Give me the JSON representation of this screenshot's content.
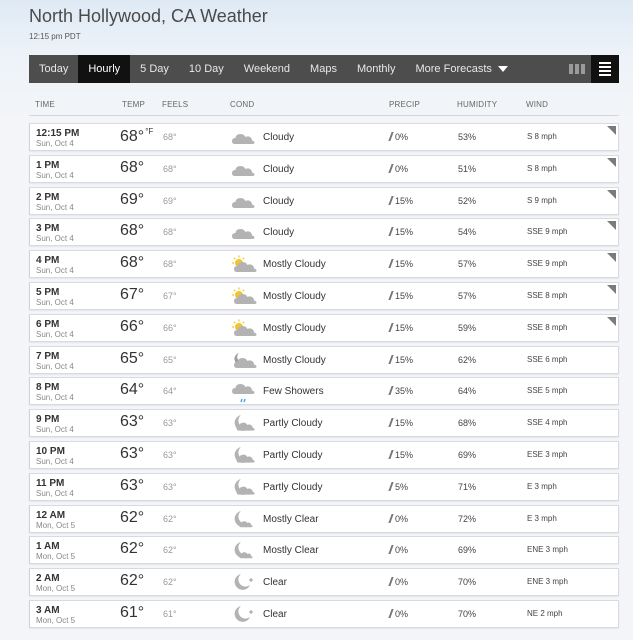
{
  "header": {
    "title": "North Hollywood, CA Weather",
    "timestamp": "12:15 pm PDT"
  },
  "nav": {
    "tabs": [
      "Today",
      "Hourly",
      "5 Day",
      "10 Day",
      "Weekend",
      "Maps",
      "Monthly",
      "More Forecasts"
    ],
    "active": "Hourly"
  },
  "columns": {
    "time": "TIME",
    "temp": "TEMP",
    "feels": "FEELS",
    "cond": "COND",
    "precip": "PRECIP",
    "humidity": "HUMIDITY",
    "wind": "WIND"
  },
  "rows": [
    {
      "time": "12:15 PM",
      "date": "Sun, Oct 4",
      "temp": "68°",
      "unit": "°F",
      "feels": "68°",
      "icon": "cloudy-icon",
      "cond": "Cloudy",
      "precip": "0%",
      "humidity": "53%",
      "wind": "S 8 mph",
      "expand": true
    },
    {
      "time": "1 PM",
      "date": "Sun, Oct 4",
      "temp": "68°",
      "feels": "68°",
      "icon": "cloudy-icon",
      "cond": "Cloudy",
      "precip": "0%",
      "humidity": "51%",
      "wind": "S 8 mph",
      "expand": true
    },
    {
      "time": "2 PM",
      "date": "Sun, Oct 4",
      "temp": "69°",
      "feels": "69°",
      "icon": "cloudy-icon",
      "cond": "Cloudy",
      "precip": "15%",
      "humidity": "52%",
      "wind": "S 9 mph",
      "expand": true
    },
    {
      "time": "3 PM",
      "date": "Sun, Oct 4",
      "temp": "68°",
      "feels": "68°",
      "icon": "cloudy-icon",
      "cond": "Cloudy",
      "precip": "15%",
      "humidity": "54%",
      "wind": "SSE 9 mph",
      "expand": true
    },
    {
      "time": "4 PM",
      "date": "Sun, Oct 4",
      "temp": "68°",
      "feels": "68°",
      "icon": "mostly-cloudy-day-icon",
      "cond": "Mostly Cloudy",
      "precip": "15%",
      "humidity": "57%",
      "wind": "SSE 9 mph",
      "expand": true
    },
    {
      "time": "5 PM",
      "date": "Sun, Oct 4",
      "temp": "67°",
      "feels": "67°",
      "icon": "mostly-cloudy-day-icon",
      "cond": "Mostly Cloudy",
      "precip": "15%",
      "humidity": "57%",
      "wind": "SSE 8 mph",
      "expand": true
    },
    {
      "time": "6 PM",
      "date": "Sun, Oct 4",
      "temp": "66°",
      "feels": "66°",
      "icon": "mostly-cloudy-day-icon",
      "cond": "Mostly Cloudy",
      "precip": "15%",
      "humidity": "59%",
      "wind": "SSE 8 mph",
      "expand": true
    },
    {
      "time": "7 PM",
      "date": "Sun, Oct 4",
      "temp": "65°",
      "feels": "65°",
      "icon": "mostly-cloudy-night-icon",
      "cond": "Mostly Cloudy",
      "precip": "15%",
      "humidity": "62%",
      "wind": "SSE 6 mph",
      "expand": false
    },
    {
      "time": "8 PM",
      "date": "Sun, Oct 4",
      "temp": "64°",
      "feels": "64°",
      "icon": "showers-icon",
      "cond": "Few Showers",
      "precip": "35%",
      "humidity": "64%",
      "wind": "SSE 5 mph",
      "expand": false
    },
    {
      "time": "9 PM",
      "date": "Sun, Oct 4",
      "temp": "63°",
      "feels": "63°",
      "icon": "partly-cloudy-night-icon",
      "cond": "Partly Cloudy",
      "precip": "15%",
      "humidity": "68%",
      "wind": "SSE 4 mph",
      "expand": false
    },
    {
      "time": "10 PM",
      "date": "Sun, Oct 4",
      "temp": "63°",
      "feels": "63°",
      "icon": "partly-cloudy-night-icon",
      "cond": "Partly Cloudy",
      "precip": "15%",
      "humidity": "69%",
      "wind": "ESE 3 mph",
      "expand": false
    },
    {
      "time": "11 PM",
      "date": "Sun, Oct 4",
      "temp": "63°",
      "feels": "63°",
      "icon": "partly-cloudy-night-icon",
      "cond": "Partly Cloudy",
      "precip": "5%",
      "humidity": "71%",
      "wind": "E 3 mph",
      "expand": false
    },
    {
      "time": "12 AM",
      "date": "Mon, Oct 5",
      "temp": "62°",
      "feels": "62°",
      "icon": "mostly-clear-night-icon",
      "cond": "Mostly Clear",
      "precip": "0%",
      "humidity": "72%",
      "wind": "E 3 mph",
      "expand": false
    },
    {
      "time": "1 AM",
      "date": "Mon, Oct 5",
      "temp": "62°",
      "feels": "62°",
      "icon": "mostly-clear-night-icon",
      "cond": "Mostly Clear",
      "precip": "0%",
      "humidity": "69%",
      "wind": "ENE 3 mph",
      "expand": false
    },
    {
      "time": "2 AM",
      "date": "Mon, Oct 5",
      "temp": "62°",
      "feels": "62°",
      "icon": "clear-night-icon",
      "cond": "Clear",
      "precip": "0%",
      "humidity": "70%",
      "wind": "ENE 3 mph",
      "expand": false
    },
    {
      "time": "3 AM",
      "date": "Mon, Oct 5",
      "temp": "61°",
      "feels": "61°",
      "icon": "clear-night-icon",
      "cond": "Clear",
      "precip": "0%",
      "humidity": "70%",
      "wind": "NE 2 mph",
      "expand": false
    }
  ]
}
